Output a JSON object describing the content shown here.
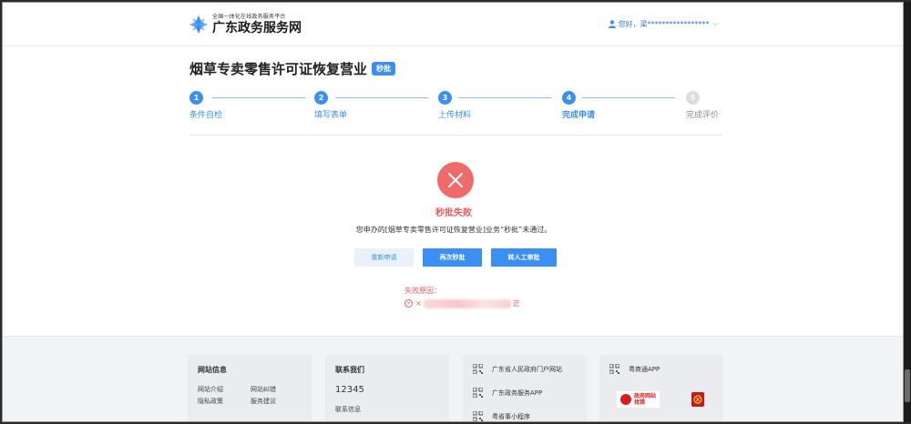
{
  "header": {
    "platform_subtitle": "全国一体化在线政务服务平台",
    "platform_name": "广东政务服务网",
    "user_greeting": "您好，梁*****************"
  },
  "page": {
    "title": "烟草专卖零售许可证恢复营业",
    "badge": "秒批"
  },
  "steps": [
    {
      "num": "1",
      "label": "条件自检",
      "state": "done"
    },
    {
      "num": "2",
      "label": "填写表单",
      "state": "done"
    },
    {
      "num": "3",
      "label": "上传材料",
      "state": "done"
    },
    {
      "num": "4",
      "label": "完成申请",
      "state": "active"
    },
    {
      "num": "5",
      "label": "完成评价",
      "state": "pending"
    }
  ],
  "result": {
    "title": "秒批失败",
    "message": "您申办的[烟草专卖零售许可证恢复营业]业务“秒批”未通过。",
    "buttons": {
      "reapply": "重新申请",
      "retry": "再次秒批",
      "manual": "转人工审批"
    },
    "reason_label": "失败原因：",
    "reason_prefix": "×",
    "reason_suffix": "正"
  },
  "footer": {
    "site_info": {
      "heading": "网站信息",
      "links": [
        "网站介绍",
        "网站纠错",
        "隐私政策",
        "服务建议"
      ]
    },
    "contact": {
      "heading": "联系我们",
      "phone": "12345",
      "info": "联系信息"
    },
    "apps": [
      {
        "label": "广东省人民政府门户网站"
      },
      {
        "label": "广东政务服务APP"
      },
      {
        "label": "粤省事小程序"
      }
    ],
    "yueshang": {
      "label": "粤商通APP",
      "gov_site_line1": "政府网站",
      "gov_site_line2": "找错"
    }
  },
  "colors": {
    "primary": "#3b8ff3",
    "danger": "#ef6b6b",
    "footer_bg": "#f2f3f5"
  }
}
